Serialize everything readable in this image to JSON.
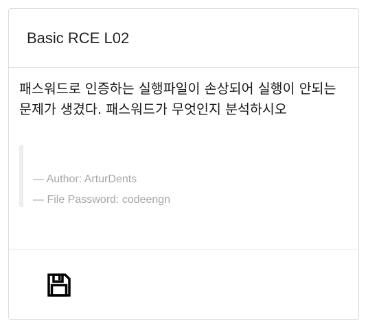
{
  "challenge": {
    "title": "Basic RCE L02",
    "description": "패스워드로 인증하는 실행파일이 손상되어 실행이 안되는 문제가 생겼다. 패스워드가 무엇인지 분석하시오",
    "author_line": "— Author: ArturDents",
    "password_line": "— File Password: codeengn"
  },
  "footer": {
    "download_icon": "floppy-disk-save-icon"
  }
}
